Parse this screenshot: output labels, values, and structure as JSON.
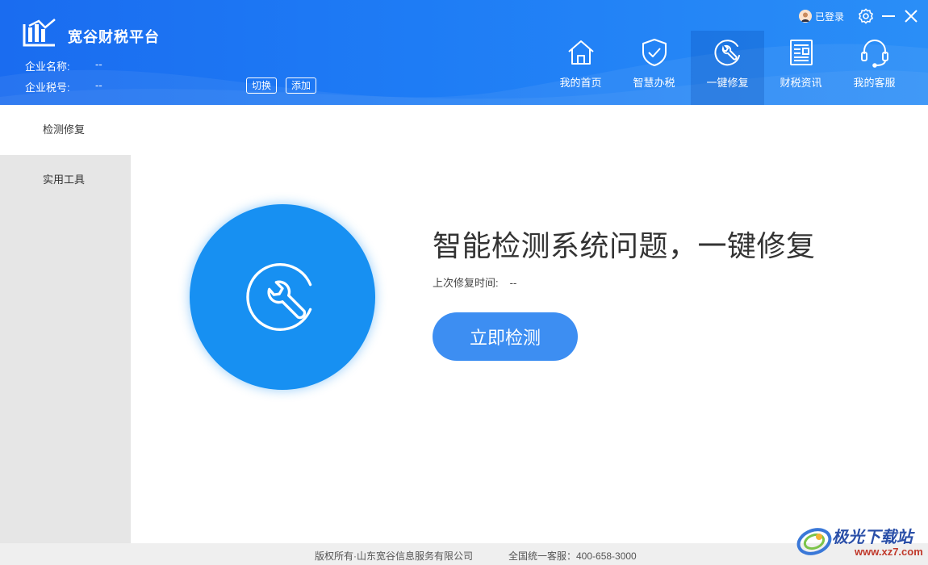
{
  "app": {
    "title": "宽谷财税平台",
    "company_name_label": "企业名称:",
    "company_name_value": "--",
    "tax_id_label": "企业税号:",
    "tax_id_value": "--",
    "switch_label": "切换",
    "add_label": "添加"
  },
  "topbar": {
    "login_status": "已登录",
    "icons": [
      "user-avatar-icon",
      "gear-icon",
      "minimize-icon",
      "close-icon"
    ]
  },
  "nav": {
    "items": [
      {
        "label": "我的首页",
        "icon": "home-icon"
      },
      {
        "label": "智慧办税",
        "icon": "shield-check-icon"
      },
      {
        "label": "一键修复",
        "icon": "wrench-repair-icon",
        "active": true
      },
      {
        "label": "财税资讯",
        "icon": "newspaper-icon"
      },
      {
        "label": "我的客服",
        "icon": "headset-icon"
      }
    ]
  },
  "sidebar": {
    "items": [
      {
        "label": "检测修复",
        "active": true
      },
      {
        "label": "实用工具",
        "active": false
      }
    ]
  },
  "main": {
    "headline": "智能检测系统问题，一键修复",
    "last_repair_label": "上次修复时间:",
    "last_repair_value": "--",
    "detect_button": "立即检测"
  },
  "footer": {
    "copyright": "版权所有·山东宽谷信息服务有限公司",
    "hotline": "全国统一客服：400-658-3000"
  },
  "watermark": {
    "title": "极光下载站",
    "url": "www.xz7.com"
  },
  "colors": {
    "header_blue": "#1e7cf5",
    "accent": "#1790f2",
    "button": "#3d8ef2",
    "sidebar_bg": "#e6e6e6"
  }
}
